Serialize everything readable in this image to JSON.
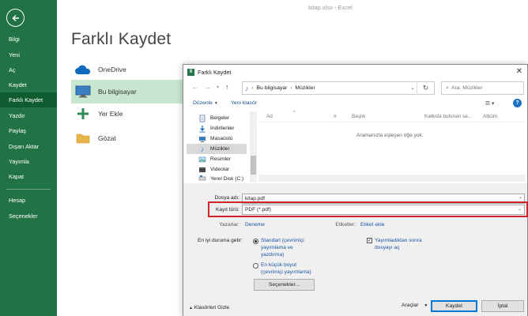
{
  "window_title": "kitap.xlsx - Excel",
  "colors": {
    "excel_green": "#217346",
    "nav_active": "#0e5c2f",
    "selected_location": "#c8e6d0",
    "highlight_red": "#d2232a",
    "link_blue": "#1a56a0"
  },
  "nav": {
    "back_icon": "back-arrow-icon",
    "items": [
      {
        "label": "Bilgi"
      },
      {
        "label": "Yeni"
      },
      {
        "label": "Aç"
      },
      {
        "label": "Kaydet"
      },
      {
        "label": "Farklı Kaydet",
        "active": true
      },
      {
        "label": "Yazdır"
      },
      {
        "label": "Paylaş"
      },
      {
        "label": "Dışarı Aktar"
      },
      {
        "label": "Yayımla"
      },
      {
        "label": "Kapat"
      },
      {
        "label": "Hesap"
      },
      {
        "label": "Seçenekler"
      }
    ]
  },
  "page_title": "Farklı Kaydet",
  "locations": [
    {
      "label": "OneDrive",
      "icon": "onedrive-cloud-icon"
    },
    {
      "label": "Bu bilgisayar",
      "icon": "computer-icon",
      "selected": true
    },
    {
      "label": "Yer Ekle",
      "icon": "add-place-icon"
    },
    {
      "label": "Gözat",
      "icon": "folder-icon"
    }
  ],
  "dialog": {
    "title": "Farklı Kaydet",
    "address": {
      "root": "Bu bilgisayar",
      "folder": "Müzikler"
    },
    "search_placeholder": "Ara: Müzikler",
    "toolbar": {
      "organize": "Düzenle",
      "new_folder": "Yeni klasör"
    },
    "tree": [
      {
        "label": "Belgeler",
        "icon": "documents-icon"
      },
      {
        "label": "İndirilenler",
        "icon": "downloads-icon"
      },
      {
        "label": "Masaüstü",
        "icon": "desktop-icon"
      },
      {
        "label": "Müzikler",
        "icon": "music-icon",
        "selected": true
      },
      {
        "label": "Resimler",
        "icon": "pictures-icon"
      },
      {
        "label": "Videolar",
        "icon": "videos-icon"
      },
      {
        "label": "Yerel Disk (C:)",
        "icon": "drive-icon"
      }
    ],
    "columns": {
      "name": "Ad",
      "number": "#",
      "title": "Başlık",
      "album_artist": "Katkıda bulunan sa...",
      "album": "Albüm"
    },
    "empty_message": "Aramanızla eşleşen öğe yok.",
    "filename_label": "Dosya adı:",
    "filename_value": "kitap.pdf",
    "filetype_label": "Kayıt türü:",
    "filetype_value": "PDF (*.pdf)",
    "authors_label": "Yazarlar:",
    "authors_value": "Deneme",
    "tags_label": "Etiketler:",
    "tags_value": "Etiket ekle",
    "optimize_label": "En iyi duruma getir:",
    "option_standard": "Standart (çevrimiçi yayımlama ve yazdırma)",
    "option_minimum": "En küçük boyut (çevrimiçi yayımlama)",
    "open_after_publish": "Yayımladıktan sonra dosyayı aç",
    "options_button": "Seçenekler...",
    "hide_folders": "Klasörleri Gizle",
    "tools": "Araçlar",
    "save_button": "Kaydet",
    "cancel_button": "İptal"
  }
}
